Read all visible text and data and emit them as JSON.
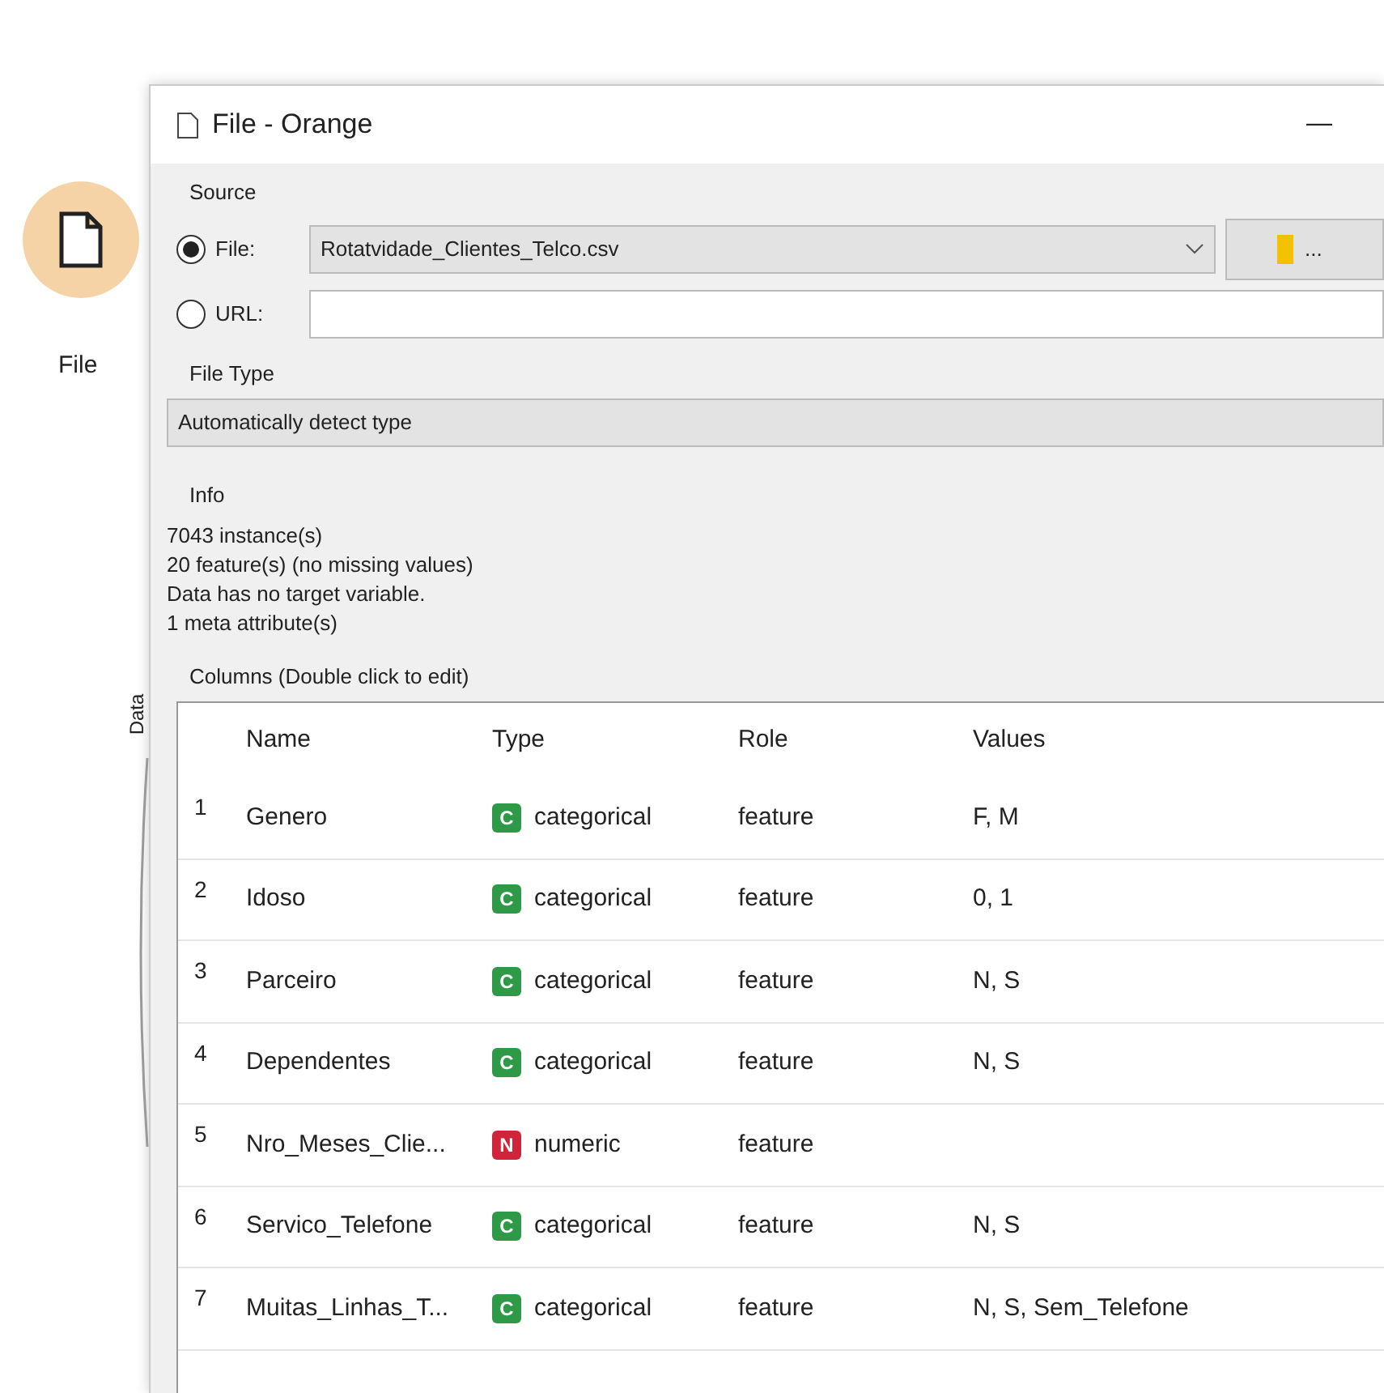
{
  "canvas": {
    "node": {
      "label": "File"
    },
    "link_label": "Data"
  },
  "window": {
    "title": "File - Orange",
    "minimize": "—"
  },
  "source": {
    "title": "Source",
    "options": [
      {
        "label": "File:",
        "selected": true,
        "kind": "file",
        "value": "Rotatvidade_Clientes_Telco.csv",
        "button": "..."
      },
      {
        "label": "URL:",
        "selected": false,
        "kind": "url"
      }
    ]
  },
  "file_type": {
    "title": "File Type",
    "value": "Automatically detect type"
  },
  "info": {
    "title": "Info",
    "lines": [
      "7043 instance(s)",
      "20 feature(s) (no missing values)",
      "Data has no target variable.",
      "1 meta attribute(s)"
    ]
  },
  "columns": {
    "title": "Columns (Double click to edit)",
    "headers": [
      "Name",
      "Type",
      "Role",
      "Values"
    ],
    "rows": [
      {
        "index": "1",
        "name": "Genero",
        "kind": "categorical",
        "badge": "C",
        "type": "categorical",
        "role": "feature",
        "values": "F, M"
      },
      {
        "index": "2",
        "name": "Idoso",
        "kind": "categorical",
        "badge": "C",
        "type": "categorical",
        "role": "feature",
        "values": "0, 1"
      },
      {
        "index": "3",
        "name": "Parceiro",
        "kind": "categorical",
        "badge": "C",
        "type": "categorical",
        "role": "feature",
        "values": "N, S"
      },
      {
        "index": "4",
        "name": "Dependentes",
        "kind": "categorical",
        "badge": "C",
        "type": "categorical",
        "role": "feature",
        "values": "N, S"
      },
      {
        "index": "5",
        "name": "Nro_Meses_Clie...",
        "kind": "numeric",
        "badge": "N",
        "type": "numeric",
        "role": "feature",
        "values": ""
      },
      {
        "index": "6",
        "name": "Servico_Telefone",
        "kind": "categorical",
        "badge": "C",
        "type": "categorical",
        "role": "feature",
        "values": "N, S"
      },
      {
        "index": "7",
        "name": "Muitas_Linhas_T...",
        "kind": "categorical",
        "badge": "C",
        "type": "categorical",
        "role": "feature",
        "values": "N, S, Sem_Telefone"
      }
    ]
  }
}
